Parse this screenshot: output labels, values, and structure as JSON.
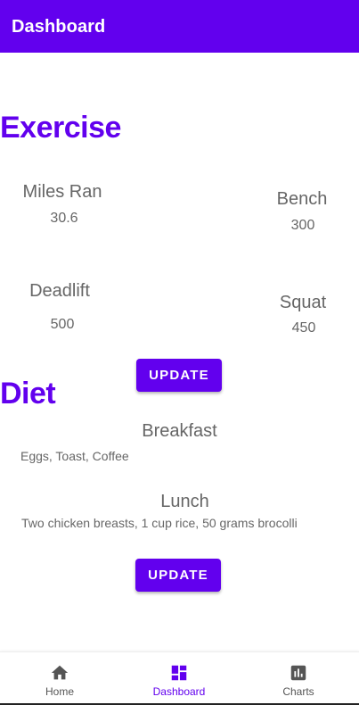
{
  "appbar": {
    "title": "Dashboard"
  },
  "exercise": {
    "title": "Exercise",
    "stats": [
      {
        "label": "Miles Ran",
        "value": "30.6"
      },
      {
        "label": "Bench",
        "value": "300"
      },
      {
        "label": "Deadlift",
        "value": "500"
      },
      {
        "label": "Squat",
        "value": "450"
      }
    ],
    "update_label": "UPDATE"
  },
  "diet": {
    "title": "Diet",
    "meals": [
      {
        "label": "Breakfast",
        "text": "Eggs, Toast, Coffee"
      },
      {
        "label": "Lunch",
        "text": "Two chicken breasts, 1 cup rice, 50 grams brocolli"
      }
    ],
    "update_label": "UPDATE"
  },
  "bottom_nav": {
    "items": [
      {
        "label": "Home",
        "icon": "home-icon"
      },
      {
        "label": "Dashboard",
        "icon": "dashboard-icon",
        "active": true
      },
      {
        "label": "Charts",
        "icon": "bar-chart-icon"
      }
    ]
  },
  "colors": {
    "accent": "#6200ee",
    "text": "#666666"
  }
}
